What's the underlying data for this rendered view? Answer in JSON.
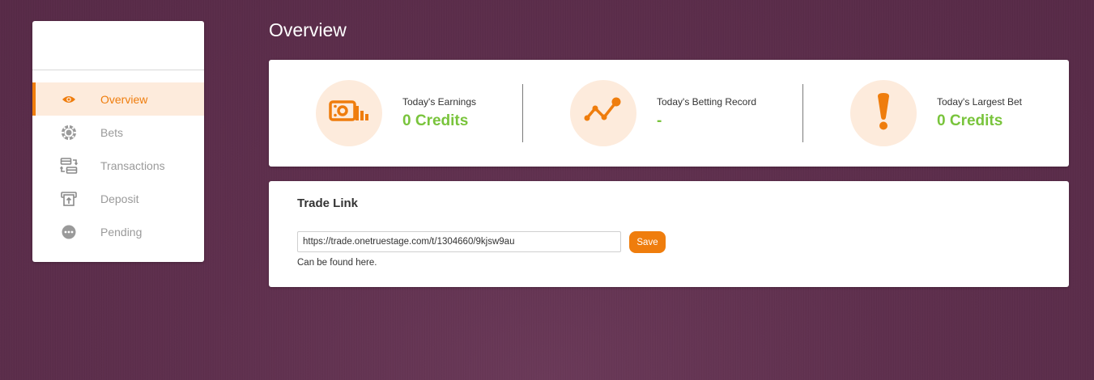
{
  "colors": {
    "accent": "#ef7d0d",
    "accent_light": "#fdebdc",
    "success": "#79c43c",
    "background": "#5e2f4d"
  },
  "sidebar": {
    "items": [
      {
        "label": "Overview",
        "icon": "eye-icon",
        "active": true
      },
      {
        "label": "Bets",
        "icon": "poker-chip-icon",
        "active": false
      },
      {
        "label": "Transactions",
        "icon": "transfer-icon",
        "active": false
      },
      {
        "label": "Deposit",
        "icon": "atm-deposit-icon",
        "active": false
      },
      {
        "label": "Pending",
        "icon": "more-dots-icon",
        "active": false
      }
    ]
  },
  "main": {
    "title": "Overview",
    "stats": [
      {
        "label": "Today's Earnings",
        "value": "0 Credits",
        "icon": "money-chart-icon"
      },
      {
        "label": "Today's Betting Record",
        "value": "-",
        "icon": "trend-line-icon"
      },
      {
        "label": "Today's Largest Bet",
        "value": "0 Credits",
        "icon": "exclamation-icon"
      }
    ],
    "trade_link": {
      "title": "Trade Link",
      "input_value": "https://trade.onetruestage.com/t/1304660/9kjsw9au",
      "save_label": "Save",
      "help_prefix": "Can be found ",
      "help_link": "here",
      "help_suffix": "."
    }
  }
}
